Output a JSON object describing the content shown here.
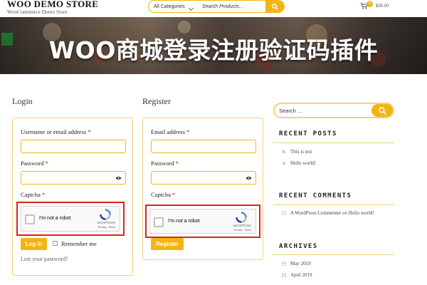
{
  "header": {
    "brand_title": "WOO DEMO STORE",
    "brand_subtitle": "WooCommerce Demo Store",
    "category_select": "All Categories",
    "search_placeholder": "Search Products...",
    "cart_count": "0",
    "cart_total": "$35.00"
  },
  "banner": {
    "title": "WOO商城登录注册验证码插件"
  },
  "login": {
    "heading": "Login",
    "username_label": "Username or email address",
    "password_label": "Password",
    "captcha_label": "Captcha",
    "required_mark": "*",
    "button_label": "Log in",
    "remember_label": "Remember me",
    "lost_password": "Lost your password?"
  },
  "register": {
    "heading": "Register",
    "email_label": "Email address",
    "password_label": "Password",
    "captcha_label": "Captcha",
    "required_mark": "*",
    "button_label": "Register"
  },
  "recaptcha": {
    "checkbox_text": "I'm not a robot",
    "brand": "reCAPTCHA",
    "links": "Privacy - Terms"
  },
  "sidebar": {
    "search_placeholder": "Search ...",
    "recent_posts": {
      "title": "RECENT POSTS",
      "items": [
        "This is test",
        "Hello world!"
      ]
    },
    "recent_comments": {
      "title": "RECENT COMMENTS",
      "author": "A WordPress Commenter",
      "on": "on",
      "post": "Hello world!"
    },
    "archives": {
      "title": "ARCHIVES",
      "items": [
        "May 2019",
        "April 2019"
      ]
    }
  },
  "colors": {
    "accent": "#f3b514",
    "highlight": "#e02020"
  }
}
